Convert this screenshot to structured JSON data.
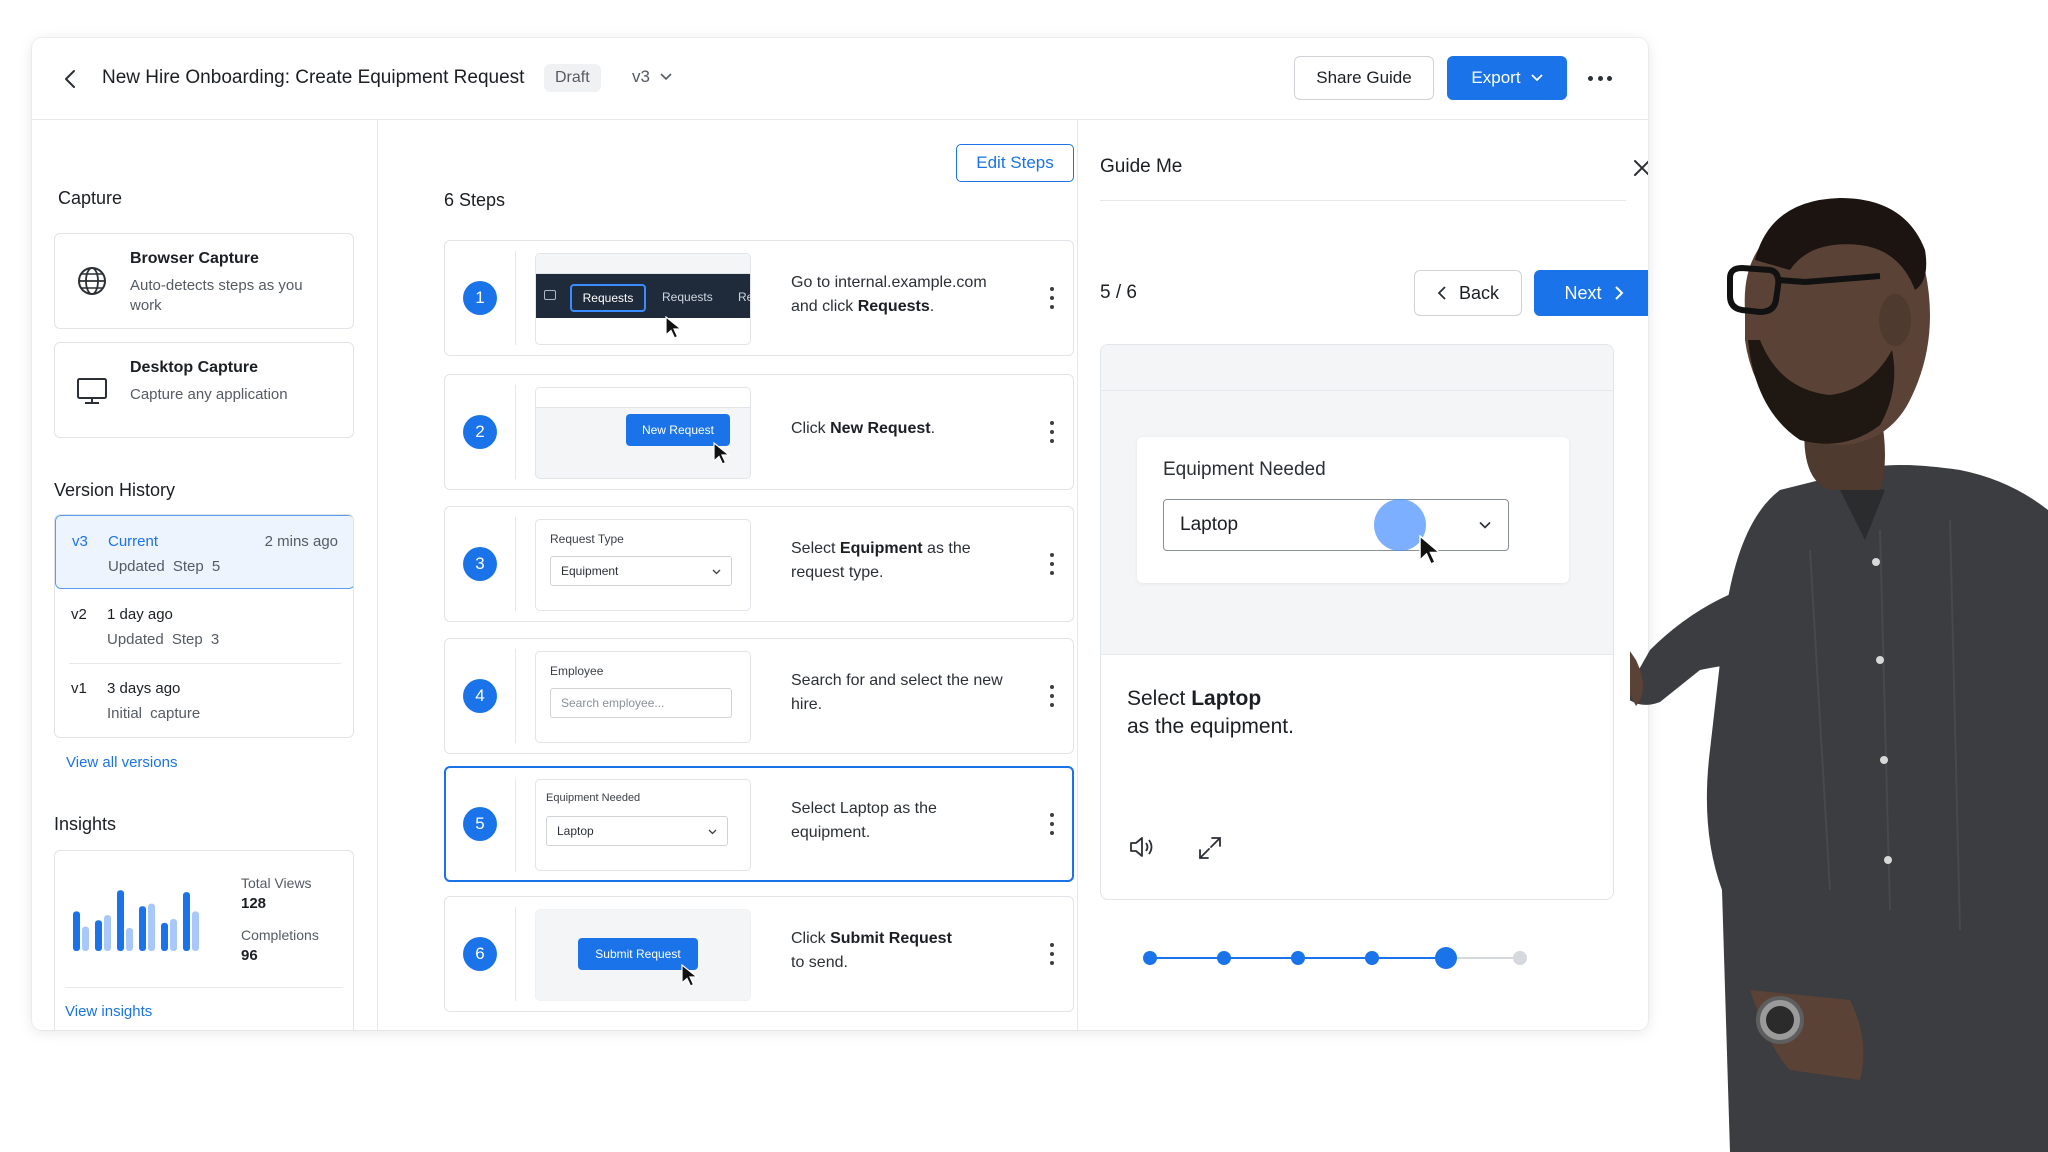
{
  "header": {
    "title": "New Hire Onboarding: Create Equipment Request",
    "status_badge": "Draft",
    "version": "v3",
    "share_label": "Share Guide",
    "export_label": "Export"
  },
  "capture": {
    "title": "Capture",
    "items": [
      {
        "name": "Browser Capture",
        "desc": "Auto-detects steps as you work",
        "icon": "globe-icon"
      },
      {
        "name": "Desktop Capture",
        "desc": "Capture any application",
        "icon": "monitor-icon"
      }
    ]
  },
  "version_history": {
    "title": "Version History",
    "items": [
      {
        "version": "v3",
        "name": "Current",
        "time": "2 mins ago",
        "sub": "Updated  Step 5"
      },
      {
        "version": "v2",
        "name": "1 day ago",
        "time": "",
        "sub": "Updated  Step 3"
      },
      {
        "version": "v1",
        "name": "3 days ago",
        "time": "",
        "sub": "Initial capture"
      }
    ],
    "view_all": "View all versions"
  },
  "insights": {
    "title": "Insights",
    "total_views_label": "Total Views",
    "total_views": "128",
    "completions_label": "Completions",
    "completions": "96",
    "view_link": "View insights",
    "bars": [
      {
        "dark": 0.62,
        "light": 0.38
      },
      {
        "dark": 0.48,
        "light": 0.56
      },
      {
        "dark": 0.95,
        "light": 0.36
      },
      {
        "dark": 0.7,
        "light": 0.74
      },
      {
        "dark": 0.44,
        "light": 0.5
      },
      {
        "dark": 0.92,
        "light": 0.62
      }
    ]
  },
  "steps": {
    "count_label": "6 Steps",
    "edit_label": "Edit Steps",
    "items": [
      {
        "num": "1",
        "text_pre": "Go to internal.example.com and click ",
        "text_bold": "Requests",
        "text_post": "."
      },
      {
        "num": "2",
        "text_pre": "Click ",
        "text_bold": "New Request",
        "text_post": "."
      },
      {
        "num": "3",
        "text_pre": "Select ",
        "text_bold": "Equipment",
        "text_post": " as the request type."
      },
      {
        "num": "4",
        "text_pre": "Search for and select the new hire.",
        "text_bold": "",
        "text_post": ""
      },
      {
        "num": "5",
        "text_pre": "Select Laptop as the equipment.",
        "text_bold": "",
        "text_post": ""
      },
      {
        "num": "6",
        "text_pre": "Click ",
        "text_bold": "Submit Request",
        "text_post": " to send."
      }
    ],
    "thumbs": {
      "requests_tab": "Requests",
      "requests_tab_2": "Requests",
      "requests_tab_3": "Re",
      "new_request": "New Request",
      "request_type_label": "Request Type",
      "request_type_value": "Equipment",
      "employee_label": "Employee",
      "employee_placeholder": "Search employee...",
      "equipment_label": "Equipment Needed",
      "equipment_value": "Laptop",
      "submit_request": "Submit Request"
    }
  },
  "guide": {
    "title": "Guide Me",
    "progress_text": "5 / 6",
    "current_step": 5,
    "total_steps": 6,
    "back_label": "Back",
    "next_label": "Next",
    "field_label": "Equipment Needed",
    "field_value": "Laptop",
    "instruction_pre": "Select ",
    "instruction_bold": "Laptop",
    "instruction_post": "as the equipment."
  },
  "colors": {
    "accent": "#1a73e8",
    "accent_light": "#eef4fe"
  }
}
